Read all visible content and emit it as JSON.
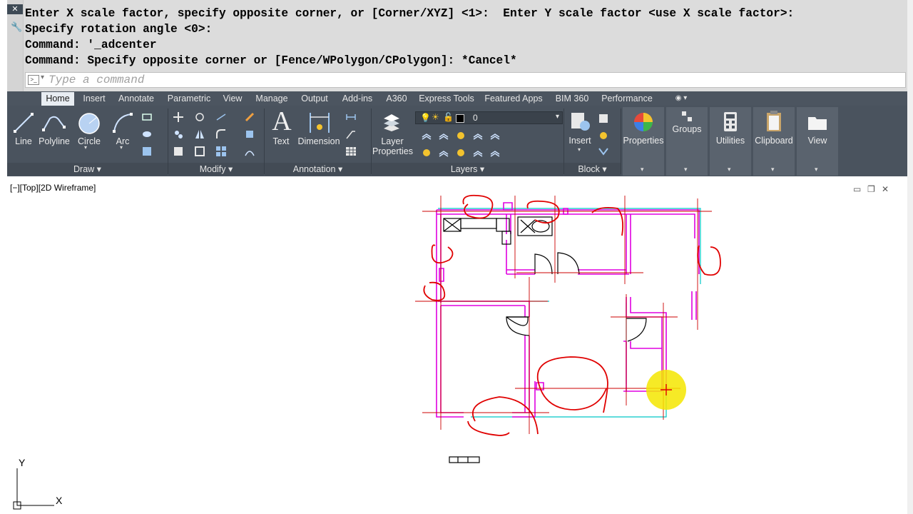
{
  "command_window": {
    "close_icon": "close-icon",
    "wrench_icon": "wrench-icon",
    "history": [
      "Enter X scale factor, specify opposite corner, or [Corner/XYZ] <1>:  Enter Y scale factor <use X scale factor>:",
      "Specify rotation angle <0>:",
      "Command: '_adcenter",
      "Command: Specify opposite corner or [Fence/WPolygon/CPolygon]: *Cancel*"
    ],
    "input_placeholder": "Type a command"
  },
  "ribbon": {
    "tabs": [
      "Home",
      "Insert",
      "Annotate",
      "Parametric",
      "View",
      "Manage",
      "Output",
      "Add-ins",
      "A360",
      "Express Tools",
      "Featured Apps",
      "BIM 360",
      "Performance"
    ],
    "active_tab": "Home",
    "draw": {
      "title": "Draw",
      "line": "Line",
      "polyline": "Polyline",
      "circle": "Circle",
      "arc": "Arc"
    },
    "modify": {
      "title": "Modify"
    },
    "annotation": {
      "title": "Annotation",
      "text": "Text",
      "dimension": "Dimension"
    },
    "layers": {
      "title": "Layers",
      "layer_properties_line1": "Layer",
      "layer_properties_line2": "Properties",
      "current_layer": "0"
    },
    "block": {
      "title": "Block",
      "insert": "Insert"
    },
    "properties": "Properties",
    "groups": "Groups",
    "utilities": "Utilities",
    "clipboard": "Clipboard",
    "view": "View"
  },
  "viewport": {
    "label": "[−][Top][2D Wireframe]",
    "ucs_x": "X",
    "ucs_y": "Y"
  },
  "colors": {
    "ribbon_bg": "#4a535e",
    "tab_bar": "#4c5560",
    "walls": "#e000e0",
    "markup": "#e00000",
    "cyan_lines": "#00c8c8",
    "cursor_highlight": "#f5e600"
  }
}
